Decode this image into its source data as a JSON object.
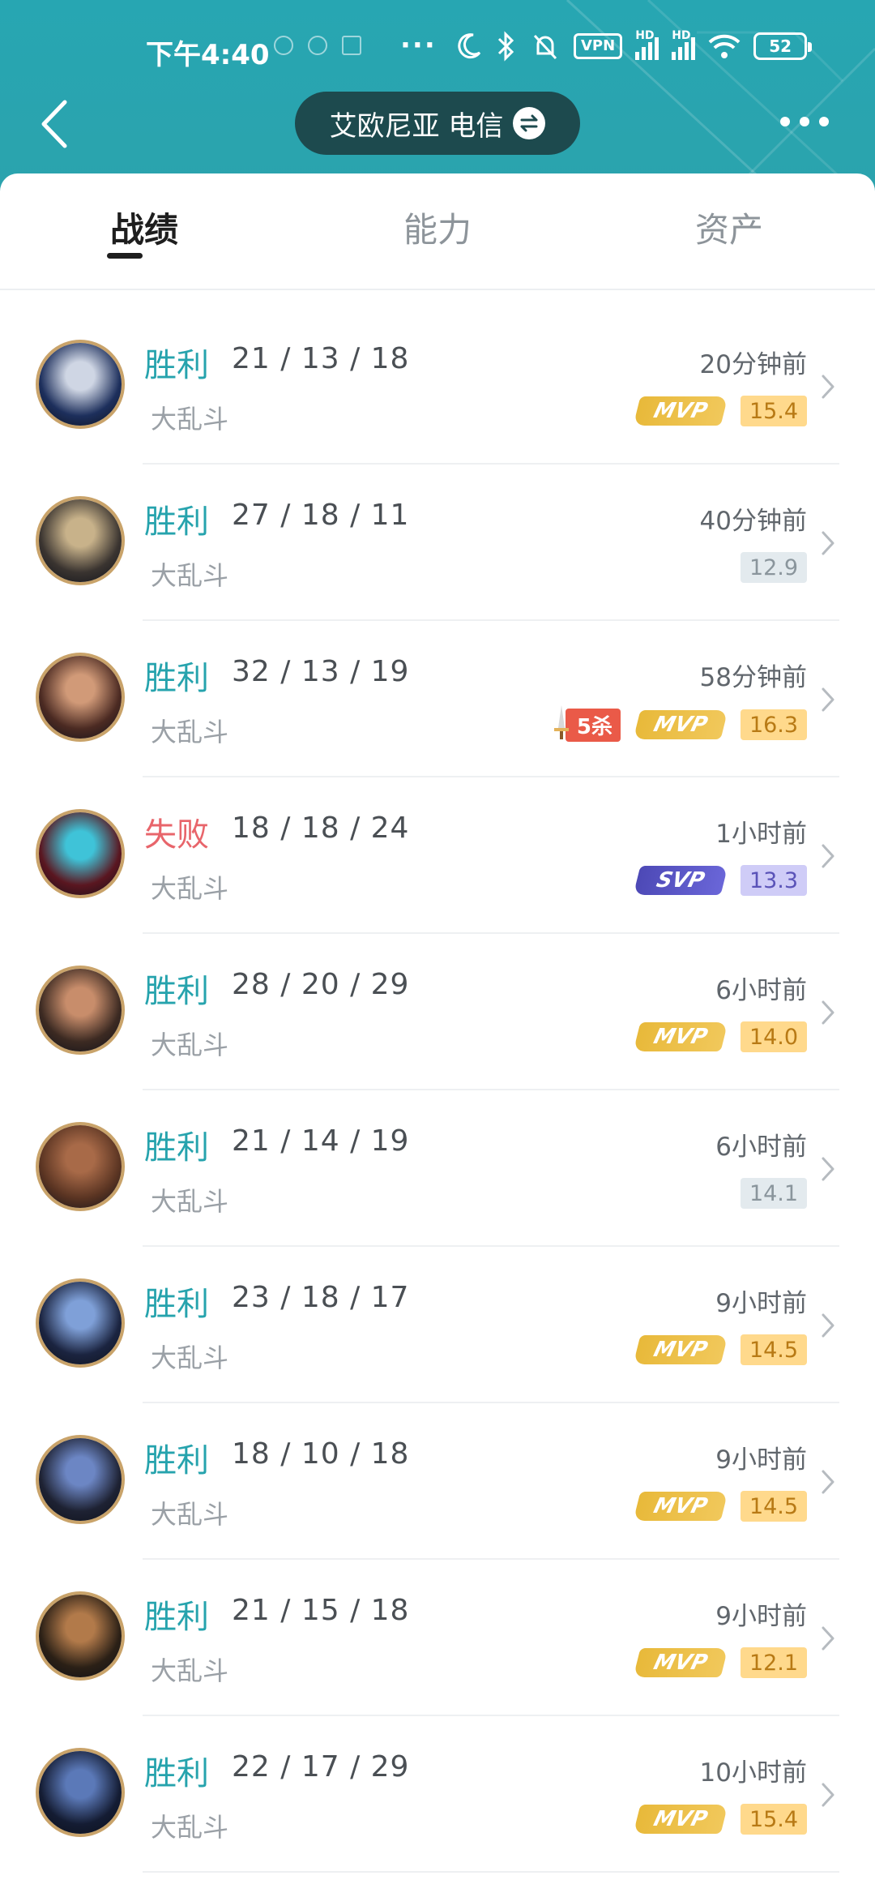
{
  "status_bar": {
    "time": "下午4:40",
    "dots": "···",
    "vpn": "VPN",
    "hd1": "HD",
    "hd2": "HD",
    "battery": "52"
  },
  "header": {
    "server_name": "艾欧尼亚 电信",
    "back_icon": "chevron-left-icon",
    "more_icon": "more-dots-icon",
    "swap_icon": "swap-arrows-icon"
  },
  "tabs": [
    {
      "label": "战绩",
      "active": true
    },
    {
      "label": "能力",
      "active": false
    },
    {
      "label": "资产",
      "active": false
    }
  ],
  "colors": {
    "header_bg": "#27a6b2",
    "win": "#26a3ad",
    "lose": "#e8656b",
    "mvp_gold": "#e8b93a",
    "svp_purple": "#4d49b6"
  },
  "matches": [
    {
      "result": "胜利",
      "kda": "21 / 13 / 18",
      "mode": "大乱斗",
      "time": "20分钟前",
      "badge": "MVP",
      "score": "15.4",
      "score_style": "gold",
      "penta": ""
    },
    {
      "result": "胜利",
      "kda": "27 / 18 / 11",
      "mode": "大乱斗",
      "time": "40分钟前",
      "badge": "",
      "score": "12.9",
      "score_style": "grey",
      "penta": ""
    },
    {
      "result": "胜利",
      "kda": "32 / 13 / 19",
      "mode": "大乱斗",
      "time": "58分钟前",
      "badge": "MVP",
      "score": "16.3",
      "score_style": "gold",
      "penta": "5杀"
    },
    {
      "result": "失败",
      "kda": "18 / 18 / 24",
      "mode": "大乱斗",
      "time": "1小时前",
      "badge": "SVP",
      "score": "13.3",
      "score_style": "purple",
      "penta": ""
    },
    {
      "result": "胜利",
      "kda": "28 / 20 / 29",
      "mode": "大乱斗",
      "time": "6小时前",
      "badge": "MVP",
      "score": "14.0",
      "score_style": "gold",
      "penta": ""
    },
    {
      "result": "胜利",
      "kda": "21 / 14 / 19",
      "mode": "大乱斗",
      "time": "6小时前",
      "badge": "",
      "score": "14.1",
      "score_style": "grey",
      "penta": ""
    },
    {
      "result": "胜利",
      "kda": "23 / 18 / 17",
      "mode": "大乱斗",
      "time": "9小时前",
      "badge": "MVP",
      "score": "14.5",
      "score_style": "gold",
      "penta": ""
    },
    {
      "result": "胜利",
      "kda": "18 / 10 / 18",
      "mode": "大乱斗",
      "time": "9小时前",
      "badge": "MVP",
      "score": "14.5",
      "score_style": "gold",
      "penta": ""
    },
    {
      "result": "胜利",
      "kda": "21 / 15 / 18",
      "mode": "大乱斗",
      "time": "9小时前",
      "badge": "MVP",
      "score": "12.1",
      "score_style": "gold",
      "penta": ""
    },
    {
      "result": "胜利",
      "kda": "22 / 17 / 29",
      "mode": "大乱斗",
      "time": "10小时前",
      "badge": "MVP",
      "score": "15.4",
      "score_style": "gold",
      "penta": ""
    }
  ]
}
